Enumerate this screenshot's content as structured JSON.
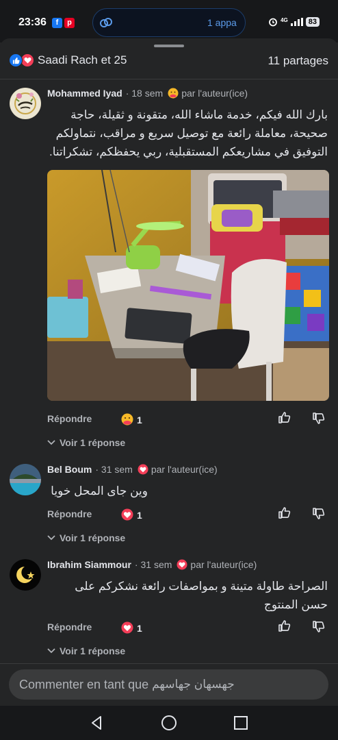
{
  "status": {
    "time": "23:36",
    "island_text": "1 appa",
    "network": "4G",
    "battery": "83"
  },
  "post": {
    "reactors": "Saadi Rach et 25",
    "shares": "11 partages"
  },
  "comments": [
    {
      "author": "Mohammed Iyad",
      "age": "18 sem",
      "author_reaction_label": "par l'auteur(ice)",
      "text": "بارك الله فيكم، خدمة ماشاء الله، متقونة و ثقيلة، حاجة صحيحة، معاملة رائعة مع توصيل سريع و مراقب، نتماولكم التوفيق في مشاريعكم المستقبلية، ربي يحفظكم، تشكراتنا.",
      "reply_label": "Répondre",
      "reaction_count": "1",
      "view_replies": "Voir 1 réponse"
    },
    {
      "author": "Bel Boum",
      "age": "31 sem",
      "author_reaction_label": "par l'auteur(ice)",
      "text": "وين جاى المحل خويا",
      "reply_label": "Répondre",
      "reaction_count": "1",
      "view_replies": "Voir 1 réponse"
    },
    {
      "author": "Ibrahim Siammour",
      "age": "31 sem",
      "author_reaction_label": "par l'auteur(ice)",
      "text": "الصراحة طاولة متينة و بمواصفات رائعة نشكركم على حسن المنتوج",
      "reply_label": "Répondre",
      "reaction_count": "1",
      "view_replies": "Voir 1 réponse"
    }
  ],
  "composer": {
    "placeholder": "Commenter en tant que",
    "user_name": "جهسهان جهاسهم"
  },
  "colors": {
    "background": "#242526",
    "like_blue": "#1877f2",
    "love_red": "#f33e58",
    "text_primary": "#e4e6eb",
    "text_secondary": "#b0b3b8"
  }
}
